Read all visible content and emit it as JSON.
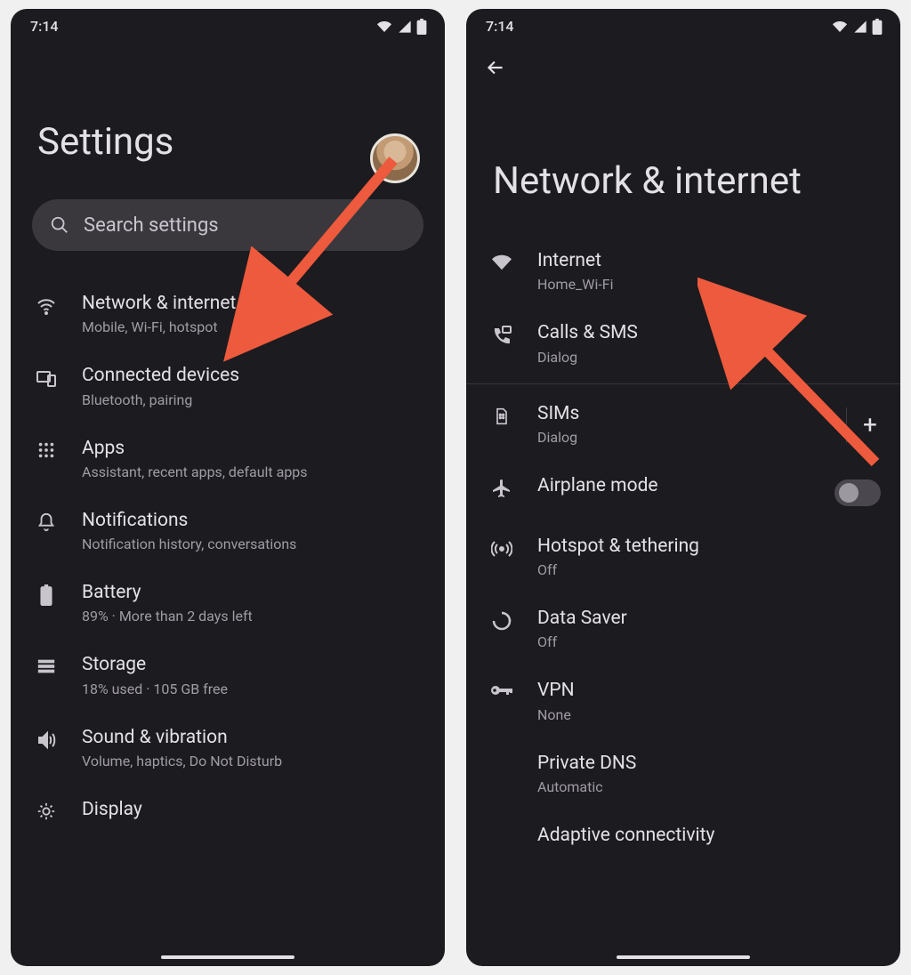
{
  "status": {
    "time": "7:14"
  },
  "left": {
    "title": "Settings",
    "search_placeholder": "Search settings",
    "items": [
      {
        "icon": "wifi",
        "title": "Network & internet",
        "sub": "Mobile, Wi-Fi, hotspot"
      },
      {
        "icon": "devices",
        "title": "Connected devices",
        "sub": "Bluetooth, pairing"
      },
      {
        "icon": "apps",
        "title": "Apps",
        "sub": "Assistant, recent apps, default apps"
      },
      {
        "icon": "bell",
        "title": "Notifications",
        "sub": "Notification history, conversations"
      },
      {
        "icon": "battery",
        "title": "Battery",
        "sub": "89% · More than 2 days left"
      },
      {
        "icon": "storage",
        "title": "Storage",
        "sub": "18% used · 105 GB free"
      },
      {
        "icon": "sound",
        "title": "Sound & vibration",
        "sub": "Volume, haptics, Do Not Disturb"
      },
      {
        "icon": "display",
        "title": "Display",
        "sub": ""
      }
    ]
  },
  "right": {
    "title": "Network & internet",
    "items": [
      {
        "icon": "wifi-solid",
        "title": "Internet",
        "sub": "Home_Wi-Fi"
      },
      {
        "icon": "calls",
        "title": "Calls & SMS",
        "sub": "Dialog"
      }
    ],
    "items2": [
      {
        "icon": "sim",
        "title": "SIMs",
        "sub": "Dialog",
        "tail": "plus"
      },
      {
        "icon": "airplane",
        "title": "Airplane mode",
        "sub": "",
        "tail": "toggle"
      },
      {
        "icon": "hotspot",
        "title": "Hotspot & tethering",
        "sub": "Off"
      },
      {
        "icon": "datasaver",
        "title": "Data Saver",
        "sub": "Off"
      },
      {
        "icon": "vpn",
        "title": "VPN",
        "sub": "None"
      },
      {
        "icon": "",
        "title": "Private DNS",
        "sub": "Automatic"
      },
      {
        "icon": "",
        "title": "Adaptive connectivity",
        "sub": ""
      }
    ]
  },
  "colors": {
    "arrow": "#ed5a3d"
  }
}
